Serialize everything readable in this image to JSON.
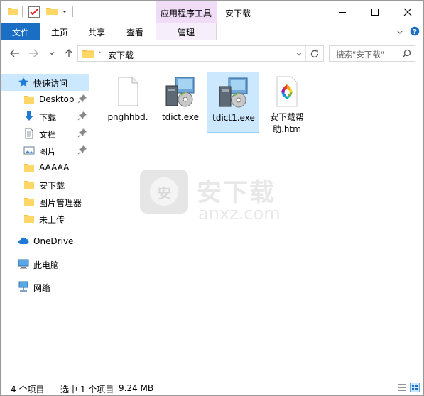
{
  "titlebar": {
    "contextual_tab": "应用程序工具",
    "window_title": "安下载"
  },
  "ribbon": {
    "file_tab": "文件",
    "tabs": [
      "主页",
      "共享",
      "查看"
    ],
    "manage_tab": "管理"
  },
  "address": {
    "path_segment": "安下载",
    "search_placeholder": "搜索\"安下载\""
  },
  "nav": {
    "quick_access": "快速访问",
    "items": [
      "Desktop",
      "下载",
      "文档",
      "图片",
      "AAAAA",
      "安下载",
      "图片管理器",
      "未上传"
    ],
    "onedrive": "OneDrive",
    "this_pc": "此电脑",
    "network": "网络"
  },
  "files": [
    {
      "name": "pnghhbd.",
      "type": "blank"
    },
    {
      "name": "tdict.exe",
      "type": "installer"
    },
    {
      "name": "tdict1.exe",
      "type": "installer",
      "selected": true
    },
    {
      "name": "安下载帮助.htm",
      "line1": "安下载帮",
      "line2": "助.htm",
      "type": "htm"
    }
  ],
  "watermark": {
    "text": "安下载",
    "domain": "anxz.com",
    "badge": "安"
  },
  "status": {
    "item_count": "4 个项目",
    "selected": "选中 1 个项目",
    "size": "9.24 MB"
  },
  "colors": {
    "accent": "#1a6ec4",
    "selection": "#cce8ff",
    "contextual": "#f0dcf6"
  }
}
